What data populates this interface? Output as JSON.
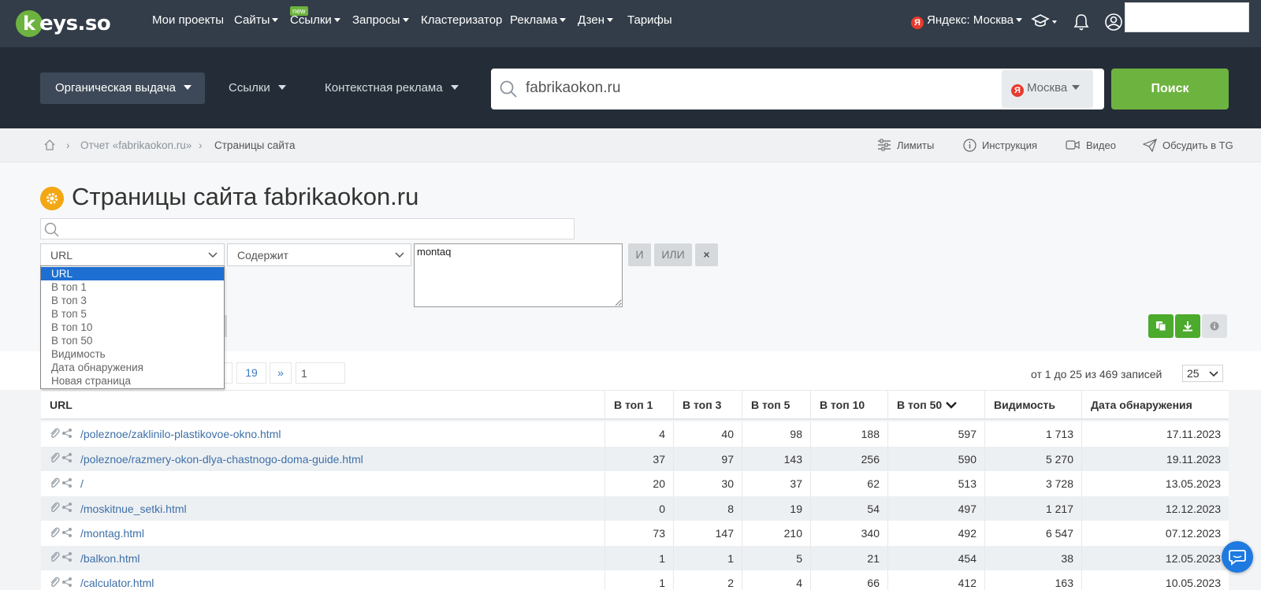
{
  "nav": {
    "logo_text": "keys.so",
    "items": [
      {
        "label": "Мои проекты",
        "caret": false
      },
      {
        "label": "Сайты",
        "caret": true
      },
      {
        "label": "Ссылки",
        "caret": true,
        "badge": "new"
      },
      {
        "label": "Запросы",
        "caret": true
      },
      {
        "label": "Кластеризатор",
        "caret": false
      },
      {
        "label": "Реклама",
        "caret": true
      },
      {
        "label": "Дзен",
        "caret": true
      },
      {
        "label": "Тарифы",
        "caret": false
      }
    ],
    "region": "Яндекс: Москва",
    "yandex_letter": "Я"
  },
  "band": {
    "tabs": [
      "Органическая выдача",
      "Ссылки",
      "Контекстная реклама"
    ],
    "search_value": "fabrikaokon.ru",
    "search_region": "Москва",
    "search_button": "Поиск"
  },
  "breadcrumb": {
    "items": [
      "Отчет «fabrikaokon.ru»",
      "Страницы сайта"
    ],
    "links": [
      "Лимиты",
      "Инструкция",
      "Видео",
      "Обсудить в TG"
    ]
  },
  "page": {
    "title": "Страницы сайта fabrikaokon.ru"
  },
  "filter": {
    "field_selected": "URL",
    "condition": "Содержит",
    "value": "montaq",
    "and_label": "И",
    "or_label": "ИЛИ",
    "remove_label": "×",
    "options": [
      "URL",
      "В топ 1",
      "В топ 3",
      "В топ 5",
      "В топ 10",
      "В топ 50",
      "Видимость",
      "Дата обнаружения",
      "Новая страница"
    ]
  },
  "pagination": {
    "last_page": "19",
    "next": "»",
    "page_input": "1",
    "count_text": "от 1 до 25 из 469 записей",
    "per_page": "25"
  },
  "table": {
    "headers": [
      "URL",
      "В топ 1",
      "В топ 3",
      "В топ 5",
      "В топ 10",
      "В топ 50",
      "Видимость",
      "Дата обнаружения"
    ],
    "rows": [
      [
        "/poleznoe/zaklinilo-plastikovoe-okno.html",
        "4",
        "40",
        "98",
        "188",
        "597",
        "1 713",
        "17.11.2023"
      ],
      [
        "/poleznoe/razmery-okon-dlya-chastnogo-doma-guide.html",
        "37",
        "97",
        "143",
        "256",
        "590",
        "5 270",
        "19.11.2023"
      ],
      [
        "/",
        "20",
        "30",
        "37",
        "62",
        "513",
        "3 728",
        "13.05.2023"
      ],
      [
        "/moskitnue_setki.html",
        "0",
        "8",
        "19",
        "54",
        "497",
        "1 217",
        "12.12.2023"
      ],
      [
        "/montag.html",
        "73",
        "147",
        "210",
        "340",
        "492",
        "6 547",
        "07.12.2023"
      ],
      [
        "/balkon.html",
        "1",
        "1",
        "5",
        "21",
        "454",
        "38",
        "12.05.2023"
      ],
      [
        "/calculator.html",
        "1",
        "2",
        "4",
        "66",
        "412",
        "163",
        "10.05.2023"
      ]
    ]
  },
  "colors": {
    "nav_bg": "#333d49",
    "band_bg": "#242d37",
    "accent_green": "#6db33f",
    "link_blue": "#3d6fa7",
    "select_blue": "#1e6fd2"
  }
}
